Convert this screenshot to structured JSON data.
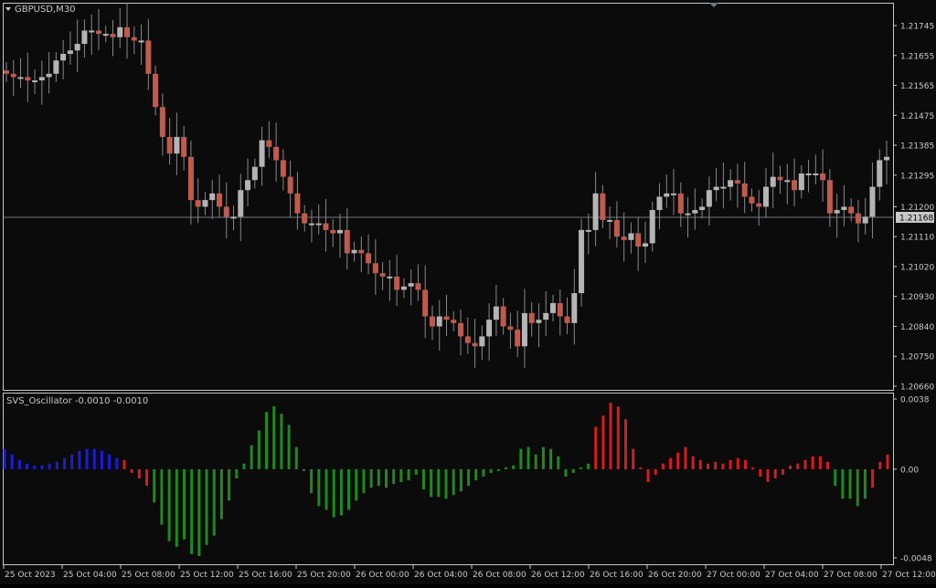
{
  "colors": {
    "background": "#0b0b0b",
    "frame": "#c8c8c8",
    "text": "#c8c8c8",
    "bull_candle": "#b4b4b4",
    "bear_candle": "#c05a4c",
    "wick": "#888888",
    "hline": "#6e7a86",
    "price_label_bg": "#c8c8c8",
    "price_label_text": "#000000",
    "osc_blue": "#1c1cd8",
    "osc_green": "#1e8a1e",
    "osc_red": "#d81c1c"
  },
  "chart": {
    "symbol_label": "GBPUSD,M30",
    "current_price_label": "1.21168",
    "indicator_label": "SVS_Oscillator -0.0010 -0.0010"
  },
  "chart_data": [
    {
      "type": "candlestick",
      "symbol": "GBPUSD",
      "timeframe": "M30",
      "ylim": [
        1.2066,
        1.2177
      ],
      "yticks": [
        "1.21745",
        "1.21655",
        "1.21565",
        "1.21475",
        "1.21385",
        "1.21295",
        "1.21200",
        "1.21110",
        "1.21020",
        "1.20930",
        "1.20840",
        "1.20750",
        "1.20660"
      ],
      "current_price": 1.21168,
      "xticks": [
        "25 Oct 2023",
        "25 Oct 04:00",
        "25 Oct 08:00",
        "25 Oct 12:00",
        "25 Oct 16:00",
        "25 Oct 20:00",
        "26 Oct 00:00",
        "26 Oct 04:00",
        "26 Oct 08:00",
        "26 Oct 12:00",
        "26 Oct 16:00",
        "26 Oct 20:00",
        "27 Oct 00:00",
        "27 Oct 04:00",
        "27 Oct 08:00",
        "27 Oct 12:00"
      ],
      "close": [
        1.216,
        1.2159,
        1.2159,
        1.2158,
        1.2158,
        1.2159,
        1.216,
        1.2164,
        1.2166,
        1.2167,
        1.2169,
        1.2173,
        1.2173,
        1.2172,
        1.2172,
        1.2171,
        1.2174,
        1.2171,
        1.217,
        1.217,
        1.216,
        1.215,
        1.2141,
        1.2136,
        1.2141,
        1.2135,
        1.2122,
        1.212,
        1.2122,
        1.2124,
        1.212,
        1.2117,
        1.2117,
        1.2125,
        1.2128,
        1.2132,
        1.214,
        1.2138,
        1.2134,
        1.2129,
        1.2124,
        1.2118,
        1.2115,
        1.2115,
        1.2115,
        1.2113,
        1.2112,
        1.2113,
        1.2106,
        1.2107,
        1.2106,
        1.2103,
        1.21,
        1.2099,
        1.2099,
        1.2095,
        1.2096,
        1.2097,
        1.2095,
        1.2087,
        1.2084,
        1.2087,
        1.2086,
        1.2085,
        1.2081,
        1.2079,
        1.2078,
        1.2081,
        1.2086,
        1.209,
        1.2084,
        1.2083,
        1.2078,
        1.2088,
        1.2085,
        1.2086,
        1.2088,
        1.2091,
        1.2087,
        1.2085,
        1.2094,
        1.2113,
        1.2113,
        1.2124,
        1.2116,
        1.2116,
        1.2111,
        1.211,
        1.2112,
        1.2108,
        1.2109,
        1.2119,
        1.2123,
        1.2124,
        1.2124,
        1.2118,
        1.2118,
        1.2119,
        1.212,
        1.2125,
        1.2126,
        1.2126,
        1.2128,
        1.2127,
        1.2123,
        1.2121,
        1.212,
        1.2126,
        1.2129,
        1.2128,
        1.2128,
        1.2125,
        1.213,
        1.213,
        1.213,
        1.2128,
        1.2118,
        1.2119,
        1.212,
        1.2118,
        1.2115,
        1.2117,
        1.2126,
        1.2134,
        1.2135
      ]
    },
    {
      "type": "histogram",
      "title": "SVS_Oscillator",
      "ylim": [
        -0.0048,
        0.0038
      ],
      "yticks": [
        "0.0038",
        "0.00",
        "-0.0048"
      ],
      "values": [
        0.0011,
        0.0008,
        0.0005,
        0.0003,
        0.0002,
        0.0002,
        0.0003,
        0.0004,
        0.0006,
        0.0008,
        0.001,
        0.0011,
        0.0011,
        0.001,
        0.0008,
        0.0006,
        0.0005,
        -0.0002,
        -0.0005,
        -0.0009,
        -0.0018,
        -0.003,
        -0.0039,
        -0.0042,
        -0.0038,
        -0.0046,
        -0.0047,
        -0.0041,
        -0.0036,
        -0.0027,
        -0.0017,
        -0.0005,
        0.0003,
        0.0013,
        0.0021,
        0.0031,
        0.0034,
        0.003,
        0.0024,
        0.0012,
        -0.0001,
        -0.0013,
        -0.002,
        -0.0022,
        -0.0026,
        -0.0025,
        -0.0022,
        -0.0017,
        -0.0013,
        -0.001,
        -0.0009,
        -0.001,
        -0.0008,
        -0.0007,
        -0.0006,
        -0.0003,
        -0.0011,
        -0.0015,
        -0.0015,
        -0.0016,
        -0.0014,
        -0.0012,
        -0.0009,
        -0.0006,
        -0.0004,
        -0.0002,
        -0.0001,
        0.0001,
        0.0002,
        0.0011,
        0.0012,
        0.0008,
        0.0012,
        0.0011,
        0.0007,
        -0.0004,
        -0.0002,
        0.0001,
        0.0003,
        0.0023,
        0.0029,
        0.0036,
        0.0034,
        0.0027,
        0.0011,
        0.0001,
        -0.0007,
        -0.0003,
        0.0003,
        0.0006,
        0.0009,
        0.0012,
        0.0007,
        0.0005,
        0.0003,
        0.0004,
        0.0003,
        0.0005,
        0.0006,
        0.0005,
        0.0001,
        -0.0004,
        -0.0007,
        -0.0005,
        -0.0003,
        0.0002,
        0.0003,
        0.0005,
        0.0007,
        0.0007,
        0.0004,
        -0.0009,
        -0.0016,
        -0.0016,
        -0.002,
        -0.0016,
        -0.001,
        0.0004,
        0.0008
      ]
    }
  ]
}
